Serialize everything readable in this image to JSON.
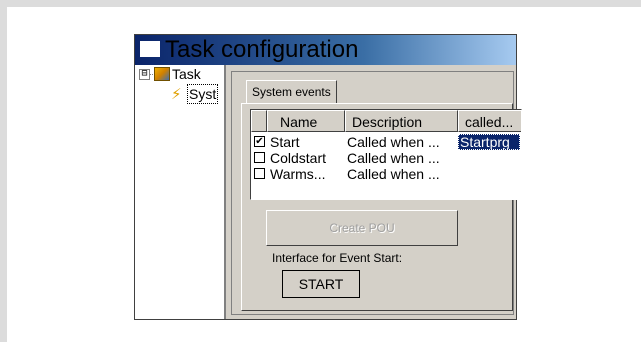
{
  "window": {
    "title": "Task configuration"
  },
  "tree": {
    "expander": "⊟",
    "root_label": "Task",
    "child_label": "Syst"
  },
  "tabs": [
    {
      "label": "System events"
    }
  ],
  "table": {
    "columns": [
      "",
      "Name",
      "Description",
      "called..."
    ],
    "rows": [
      {
        "checked": true,
        "check_glyph": "✔",
        "name": "Start",
        "description": "Called when ...",
        "called": "Startprg"
      },
      {
        "checked": false,
        "check_glyph": "",
        "name": "Coldstart",
        "description": "Called when ...",
        "called": ""
      },
      {
        "checked": false,
        "check_glyph": "",
        "name": "Warms...",
        "description": "Called when ...",
        "called": ""
      }
    ]
  },
  "create_button": {
    "label": "Create POU"
  },
  "interface": {
    "label": "Interface for Event Start:",
    "value": "START"
  },
  "colors": {
    "titlebar_start": "#0a246a",
    "titlebar_end": "#a6caf0",
    "face": "#d4d0c8",
    "selection": "#0a246a"
  }
}
